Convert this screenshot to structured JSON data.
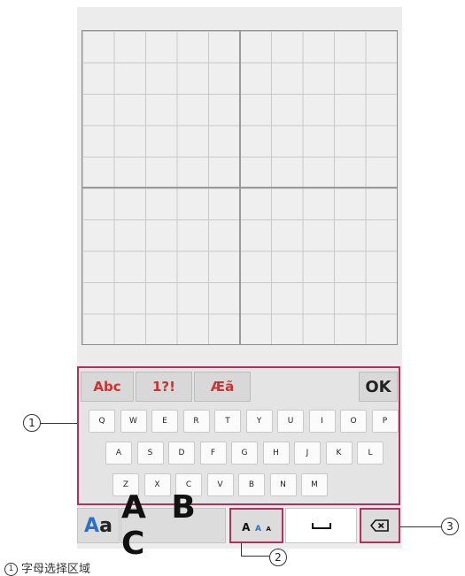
{
  "tabs": [
    {
      "label": "Abc"
    },
    {
      "label": "1?!"
    },
    {
      "label": "Æã"
    },
    {
      "label": "OK"
    }
  ],
  "keys": {
    "row1": [
      "Q",
      "W",
      "E",
      "R",
      "T",
      "Y",
      "U",
      "I",
      "O",
      "P"
    ],
    "row2": [
      "A",
      "S",
      "D",
      "F",
      "G",
      "H",
      "J",
      "K",
      "L"
    ],
    "row3": [
      "Z",
      "X",
      "C",
      "V",
      "B",
      "N",
      "M"
    ]
  },
  "toolbar": {
    "font_style_big": "A",
    "font_style_small": "a",
    "font_sample": "A B C",
    "size_large": "A",
    "size_medium": "A",
    "size_small": "A"
  },
  "callouts": {
    "one": "1",
    "two": "2",
    "three": "3"
  },
  "caption": {
    "number": "1",
    "text": "字母选择区域"
  },
  "colors": {
    "highlight": "#b03060",
    "tab_text": "#d0302e",
    "accent_blue": "#2f6fc8"
  }
}
